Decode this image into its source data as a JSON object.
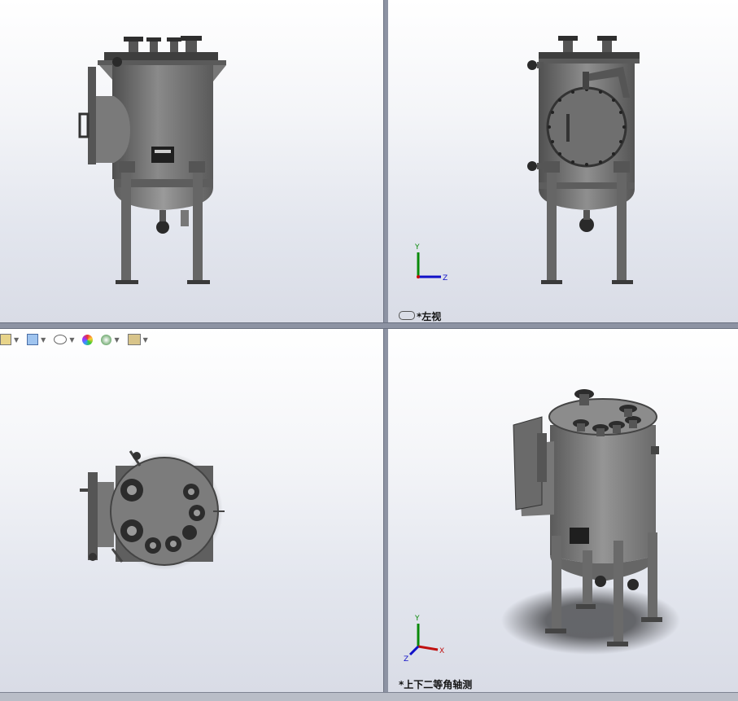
{
  "viewports": {
    "front": {
      "label": ""
    },
    "left": {
      "label": "*左视"
    },
    "top": {
      "label": ""
    },
    "iso": {
      "label": "*上下二等角轴测"
    }
  },
  "triad": {
    "x": "X",
    "y": "Y",
    "z": "Z"
  },
  "colors": {
    "steel": "#6d6d6d",
    "steel_dark": "#3a3a3a",
    "bg_top": "#ffffff",
    "bg_bottom": "#d9dce6"
  },
  "toolbar": {
    "icons": [
      "section-view-icon",
      "view-orientation-icon",
      "display-style-icon",
      "appearance-icon",
      "scene-icon",
      "view-settings-icon"
    ]
  }
}
